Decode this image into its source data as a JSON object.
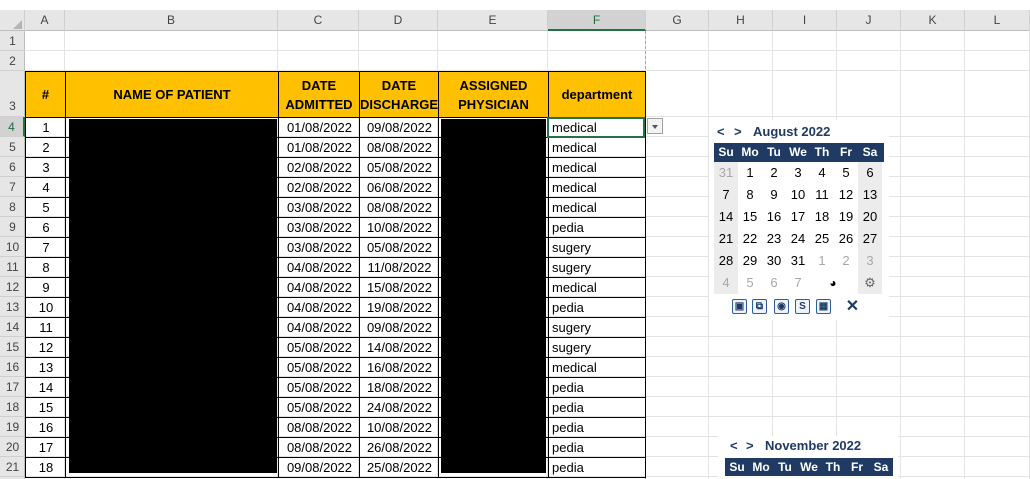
{
  "columns": [
    "A",
    "B",
    "C",
    "D",
    "E",
    "F",
    "G",
    "H",
    "I",
    "J",
    "K",
    "L"
  ],
  "rows": [
    "1",
    "2",
    "3",
    "4",
    "5",
    "6",
    "7",
    "8",
    "9",
    "10",
    "11",
    "12",
    "13",
    "14",
    "15",
    "16",
    "17",
    "18",
    "19",
    "20",
    "21"
  ],
  "table": {
    "headers": {
      "num": "#",
      "name": "NAME OF  PATIENT",
      "admitted_1": "DATE",
      "admitted_2": "ADMITTED",
      "discharge_1": "DATE",
      "discharge_2": "DISCHARGE",
      "physician_1": "ASSIGNED",
      "physician_2": "PHYSICIAN",
      "department": "department"
    },
    "rows": [
      {
        "num": "1",
        "admitted": "01/08/2022",
        "discharge": "09/08/2022",
        "department": "medical"
      },
      {
        "num": "2",
        "admitted": "01/08/2022",
        "discharge": "08/08/2022",
        "department": "medical"
      },
      {
        "num": "3",
        "admitted": "02/08/2022",
        "discharge": "05/08/2022",
        "department": "medical"
      },
      {
        "num": "4",
        "admitted": "02/08/2022",
        "discharge": "06/08/2022",
        "department": "medical"
      },
      {
        "num": "5",
        "admitted": "03/08/2022",
        "discharge": "08/08/2022",
        "department": "medical"
      },
      {
        "num": "6",
        "admitted": "03/08/2022",
        "discharge": "10/08/2022",
        "department": "pedia"
      },
      {
        "num": "7",
        "admitted": "03/08/2022",
        "discharge": "05/08/2022",
        "department": "sugery"
      },
      {
        "num": "8",
        "admitted": "04/08/2022",
        "discharge": "11/08/2022",
        "department": "sugery"
      },
      {
        "num": "9",
        "admitted": "04/08/2022",
        "discharge": "15/08/2022",
        "department": "medical"
      },
      {
        "num": "10",
        "admitted": "04/08/2022",
        "discharge": "19/08/2022",
        "department": "pedia"
      },
      {
        "num": "11",
        "admitted": "04/08/2022",
        "discharge": "09/08/2022",
        "department": "sugery"
      },
      {
        "num": "12",
        "admitted": "05/08/2022",
        "discharge": "14/08/2022",
        "department": "sugery"
      },
      {
        "num": "13",
        "admitted": "05/08/2022",
        "discharge": "16/08/2022",
        "department": "medical"
      },
      {
        "num": "14",
        "admitted": "05/08/2022",
        "discharge": "18/08/2022",
        "department": "pedia"
      },
      {
        "num": "15",
        "admitted": "05/08/2022",
        "discharge": "24/08/2022",
        "department": "pedia"
      },
      {
        "num": "16",
        "admitted": "08/08/2022",
        "discharge": "10/08/2022",
        "department": "pedia"
      },
      {
        "num": "17",
        "admitted": "08/08/2022",
        "discharge": "26/08/2022",
        "department": "pedia"
      },
      {
        "num": "18",
        "admitted": "09/08/2022",
        "discharge": "25/08/2022",
        "department": "pedia"
      }
    ]
  },
  "calendar_aug": {
    "prev": "<",
    "next": ">",
    "title": "August 2022",
    "weekdays": [
      "Su",
      "Mo",
      "Tu",
      "We",
      "Th",
      "Fr",
      "Sa"
    ],
    "weeks": [
      [
        "31",
        "1",
        "2",
        "3",
        "4",
        "5",
        "6"
      ],
      [
        "7",
        "8",
        "9",
        "10",
        "11",
        "12",
        "13"
      ],
      [
        "14",
        "15",
        "16",
        "17",
        "18",
        "19",
        "20"
      ],
      [
        "21",
        "22",
        "23",
        "24",
        "25",
        "26",
        "27"
      ],
      [
        "28",
        "29",
        "30",
        "31",
        "1",
        "2",
        "3"
      ],
      [
        "4",
        "5",
        "6",
        "7",
        "",
        "",
        ""
      ]
    ],
    "tools": [
      "window-icon",
      "windows-icon",
      "globe-icon",
      "timestamp-icon",
      "calendar-icon",
      "close-icon"
    ]
  },
  "calendar_nov": {
    "prev": "<",
    "next": ">",
    "title": "November 2022",
    "weekdays": [
      "Su",
      "Mo",
      "Tu",
      "We",
      "Th",
      "Fr",
      "Sa"
    ]
  },
  "colors": {
    "header_fill": "#ffc000",
    "calendar_accent": "#1f3b63",
    "selection": "#217346"
  }
}
